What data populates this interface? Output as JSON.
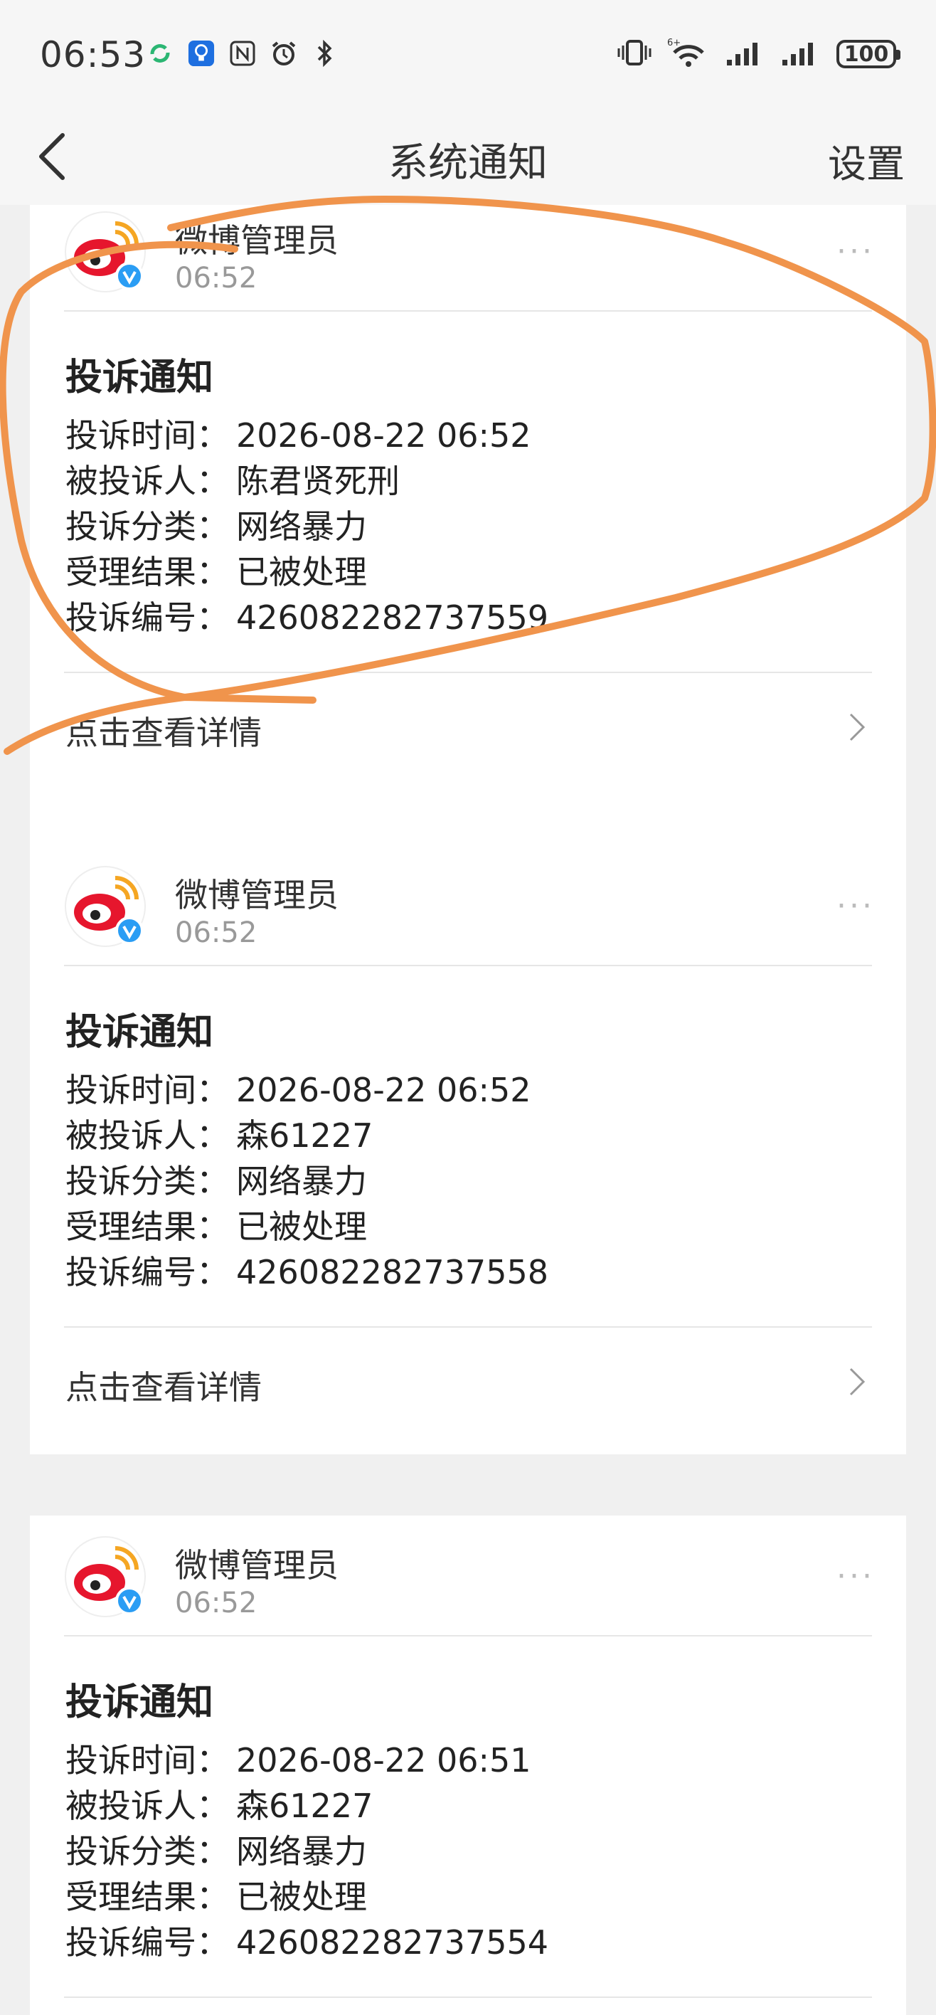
{
  "status_bar": {
    "time": "06:53",
    "battery": "100",
    "icons_left": [
      "refresh-icon",
      "lightbulb-icon",
      "nfc-icon",
      "alarm-icon",
      "bluetooth-icon"
    ],
    "icons_right": [
      "vibrate-icon",
      "wifi-icon",
      "signal-icon",
      "signal-icon"
    ]
  },
  "nav": {
    "title": "系统通知",
    "settings_label": "设置"
  },
  "notifications": [
    {
      "sender": "微博管理员",
      "time": "06:52",
      "title": "投诉通知",
      "fields": [
        {
          "label": "投诉时间：",
          "value": "2026-08-22 06:52"
        },
        {
          "label": "被投诉人：",
          "value": "陈君贤死刑"
        },
        {
          "label": "投诉分类：",
          "value": "网络暴力"
        },
        {
          "label": "受理结果：",
          "value": "已被处理"
        },
        {
          "label": "投诉编号：",
          "value": "426082282737559"
        }
      ],
      "detail_label": "点击查看详情"
    },
    {
      "sender": "微博管理员",
      "time": "06:52",
      "title": "投诉通知",
      "fields": [
        {
          "label": "投诉时间：",
          "value": "2026-08-22 06:52"
        },
        {
          "label": "被投诉人：",
          "value": "森61227"
        },
        {
          "label": "投诉分类：",
          "value": "网络暴力"
        },
        {
          "label": "受理结果：",
          "value": "已被处理"
        },
        {
          "label": "投诉编号：",
          "value": "426082282737558"
        }
      ],
      "detail_label": "点击查看详情"
    },
    {
      "sender": "微博管理员",
      "time": "06:52",
      "title": "投诉通知",
      "fields": [
        {
          "label": "投诉时间：",
          "value": "2026-08-22 06:51"
        },
        {
          "label": "被投诉人：",
          "value": "森61227"
        },
        {
          "label": "投诉分类：",
          "value": "网络暴力"
        },
        {
          "label": "受理结果：",
          "value": "已被处理"
        },
        {
          "label": "投诉编号：",
          "value": "426082282737554"
        }
      ],
      "detail_label": ""
    }
  ],
  "colors": {
    "annotation_stroke": "#f0944c",
    "page_bg": "#f0f0f0",
    "card_bg": "#ffffff",
    "weibo_red": "#e6162d",
    "verified_blue": "#2a9df4"
  }
}
